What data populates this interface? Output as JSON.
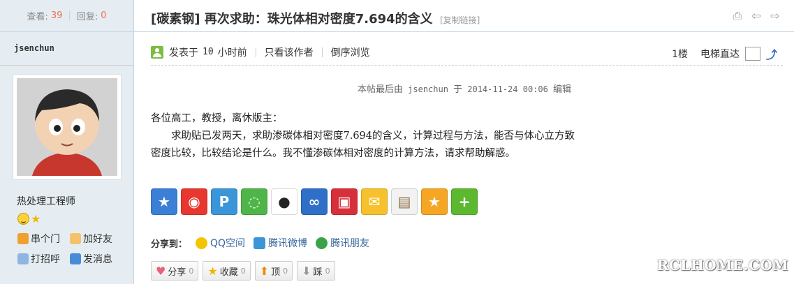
{
  "sidebar": {
    "views_label": "查看:",
    "views_count": "39",
    "replies_label": "回复:",
    "replies_count": "0",
    "author_name": "jsenchun",
    "user_title": "热处理工程师",
    "links": {
      "visit": "串个门",
      "add_friend": "加好友",
      "greet": "打招呼",
      "message": "发消息"
    }
  },
  "post": {
    "category": "[碳素钢]",
    "title": "再次求助：珠光体相对密度7.694的含义",
    "copy_link": "[复制链接]",
    "posted_prefix": "发表于",
    "posted_num": "10",
    "posted_suffix": "小时前",
    "only_author": "只看该作者",
    "reverse": "倒序浏览",
    "floor": "1楼",
    "elevator": "电梯直达",
    "edited": {
      "prefix": "本帖最后由",
      "user": "jsenchun",
      "mid": "于",
      "datetime": "2014-11-24 00:06",
      "suffix": "编辑"
    },
    "content": {
      "line1": "各位高工，教授，离休版主：",
      "para": "求助贴已发两天，求助渗碳体相对密度7.694的含义，计算过程与方法，能否与体心立方致密度比较，比较结论是什么。我不懂渗碳体相对密度的计算方法，请求帮助解惑。"
    }
  },
  "share": {
    "label": "分享到：",
    "qzone": "QQ空间",
    "tweibo": "腾讯微博",
    "tfriend": "腾讯朋友"
  },
  "actions": {
    "share": {
      "label": "分享",
      "count": "0"
    },
    "fav": {
      "label": "收藏",
      "count": "0"
    },
    "up": {
      "label": "顶",
      "count": "0"
    },
    "down": {
      "label": "踩",
      "count": "0"
    }
  },
  "watermark": "RCLHOME.COM"
}
